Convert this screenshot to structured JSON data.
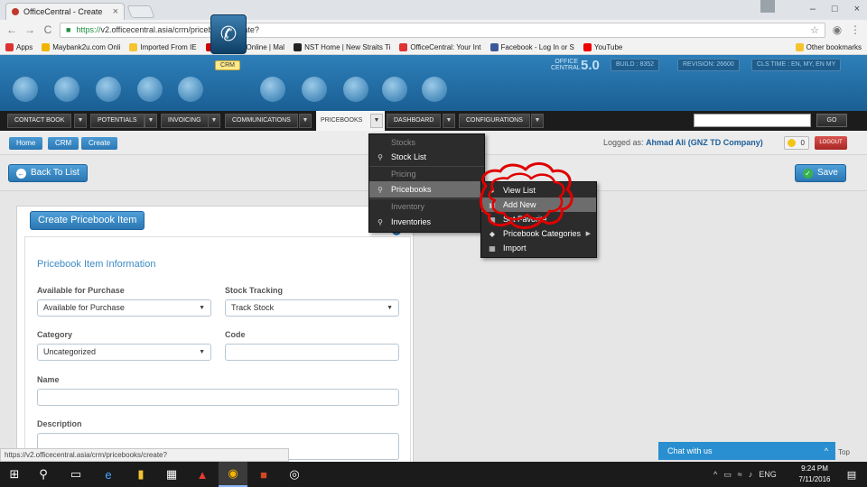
{
  "browser": {
    "tab_title": "OfficeCentral - Create",
    "tab_close": "×",
    "window_controls": [
      "–",
      "□",
      "×"
    ],
    "url_scheme": "https://",
    "url_rest": "v2.officecentral.asia/crm/pricebooks/create?",
    "back": "←",
    "forward": "→",
    "reload": "C",
    "star": "☆",
    "menu": "⋮",
    "bookmarks": [
      {
        "label": "Apps",
        "color": "#d33"
      },
      {
        "label": "Maybank2u.com Onli",
        "color": "#f0b400"
      },
      {
        "label": "Imported From IE",
        "color": "#f4c430"
      },
      {
        "label": "The Star Online | Mal",
        "color": "#c00"
      },
      {
        "label": "NST Home | New Straits Ti",
        "color": "#222"
      },
      {
        "label": "OfficeCentral: Your Int",
        "color": "#d33"
      },
      {
        "label": "Facebook - Log In or S",
        "color": "#3b5998"
      },
      {
        "label": "YouTube",
        "color": "#e00"
      }
    ],
    "other_bookmarks": "Other bookmarks"
  },
  "header": {
    "crm_label": "CRM",
    "brand_top": "OFFICE",
    "brand_bottom": "CENTRAL",
    "brand_version": "5.0",
    "info": [
      {
        "label": "BUILD : 8352"
      },
      {
        "label": "REVISION: 26600"
      },
      {
        "label": "CLS TIME : EN, MY, EN MY"
      }
    ]
  },
  "nav": {
    "items": [
      {
        "label": "CONTACT BOOK"
      },
      {
        "label": "POTENTIALS"
      },
      {
        "label": "INVOICING"
      },
      {
        "label": "COMMUNICATIONS"
      }
    ],
    "active": "PRICEBOOKS",
    "after": [
      {
        "label": "DASHBOARD"
      },
      {
        "label": "CONFIGURATIONS"
      }
    ],
    "go": "GO"
  },
  "breadcrumb": [
    "Home",
    "CRM",
    "Create"
  ],
  "session": {
    "logged_prefix": "Logged as:",
    "logged_user": "Ahmad Ali (GNZ TD Company)",
    "notif_count": "0",
    "logout": "LOGOUT"
  },
  "actions": {
    "back_to_list": "Back To List",
    "save": "Save"
  },
  "pricebook_menu": {
    "stocks_head": "Stocks",
    "stock_list": "Stock List",
    "pricing_head": "Pricing",
    "pricebooks": "Pricebooks",
    "inventory_head": "Inventory",
    "inventories": "Inventories"
  },
  "pricebooks_submenu": {
    "items": [
      "View List",
      "Add New",
      "Set Favorite",
      "Pricebook Categories",
      "Import"
    ]
  },
  "form": {
    "panel_title": "Create Pricebook Item",
    "section_title": "Pricebook Item Information",
    "available_label": "Available for Purchase",
    "available_value": "Available for Purchase",
    "stock_tracking_label": "Stock Tracking",
    "stock_tracking_value": "Track Stock",
    "category_label": "Category",
    "category_value": "Uncategorized",
    "code_label": "Code",
    "name_label": "Name",
    "description_label": "Description"
  },
  "statusbar_url": "https://v2.officecentral.asia/crm/pricebooks/create?",
  "chat": {
    "label": "Chat with us",
    "caret": "^"
  },
  "to_top": "Top",
  "taskbar": {
    "language": "ENG",
    "time": "9:24 PM",
    "date": "7/11/2016"
  },
  "colors": {
    "header_blue": "#1a5f94",
    "accent_blue": "#2b77b3",
    "menu_dark": "#2c2c2c",
    "annotation_red": "#e00000",
    "logout_red": "#a92724"
  }
}
